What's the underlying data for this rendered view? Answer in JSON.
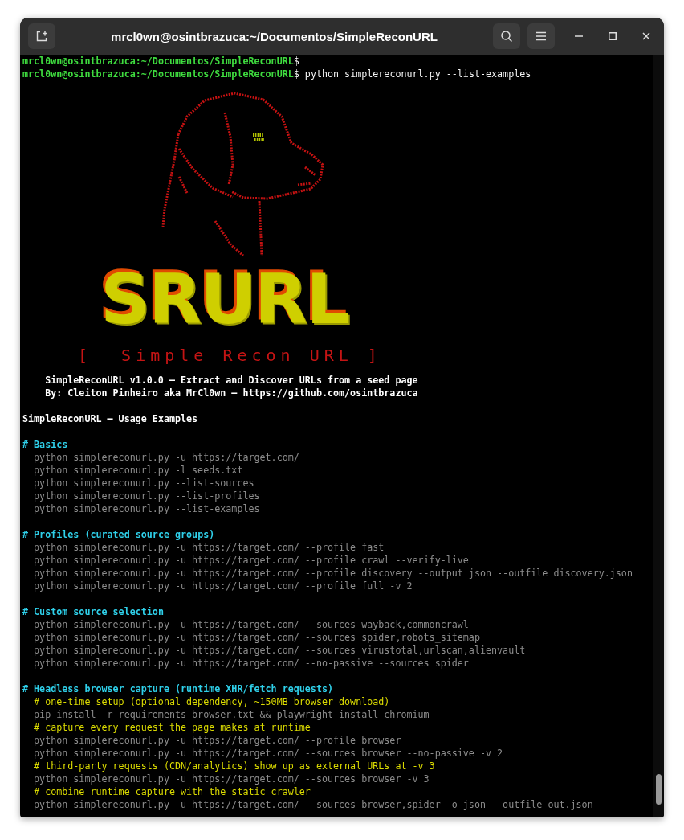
{
  "window": {
    "title": "mrcl0wn@osintbrazuca:~/Documentos/SimpleReconURL"
  },
  "terminal": {
    "prompts": [
      {
        "prompt": "mrcl0wn@osintbrazuca:~/Documentos/SimpleReconURL",
        "symbol": "$"
      },
      {
        "prompt": "mrcl0wn@osintbrazuca:~/Documentos/SimpleReconURL",
        "symbol": "$",
        "command": "python simplereconurl.py --list-examples"
      }
    ],
    "art": {
      "logo": "SRURL",
      "subtitle": "[  Simple Recon URL ]"
    },
    "banner": [
      "SimpleReconURL v1.0.0 – Extract and Discover URLs from a seed page",
      "By: Cleiton Pinheiro aka MrCl0wn – https://github.com/osintbrazuca"
    ],
    "title": "SimpleReconURL — Usage Examples",
    "sections": [
      {
        "heading": "# Basics",
        "lines": [
          {
            "kind": "command",
            "text": "python simplereconurl.py -u https://target.com/"
          },
          {
            "kind": "command",
            "text": "python simplereconurl.py -l seeds.txt"
          },
          {
            "kind": "command",
            "text": "python simplereconurl.py --list-sources"
          },
          {
            "kind": "command",
            "text": "python simplereconurl.py --list-profiles"
          },
          {
            "kind": "command",
            "text": "python simplereconurl.py --list-examples"
          }
        ]
      },
      {
        "heading": "# Profiles (curated source groups)",
        "lines": [
          {
            "kind": "command",
            "text": "python simplereconurl.py -u https://target.com/ --profile fast"
          },
          {
            "kind": "command",
            "text": "python simplereconurl.py -u https://target.com/ --profile crawl --verify-live"
          },
          {
            "kind": "command",
            "text": "python simplereconurl.py -u https://target.com/ --profile discovery --output json --outfile discovery.json"
          },
          {
            "kind": "command",
            "text": "python simplereconurl.py -u https://target.com/ --profile full -v 2"
          }
        ]
      },
      {
        "heading": "# Custom source selection",
        "lines": [
          {
            "kind": "command",
            "text": "python simplereconurl.py -u https://target.com/ --sources wayback,commoncrawl"
          },
          {
            "kind": "command",
            "text": "python simplereconurl.py -u https://target.com/ --sources spider,robots_sitemap"
          },
          {
            "kind": "command",
            "text": "python simplereconurl.py -u https://target.com/ --sources virustotal,urlscan,alienvault"
          },
          {
            "kind": "command",
            "text": "python simplereconurl.py -u https://target.com/ --no-passive --sources spider"
          }
        ]
      },
      {
        "heading": "# Headless browser capture (runtime XHR/fetch requests)",
        "lines": [
          {
            "kind": "comment",
            "text": "# one-time setup (optional dependency, ~150MB browser download)"
          },
          {
            "kind": "command",
            "text": "pip install -r requirements-browser.txt && playwright install chromium"
          },
          {
            "kind": "comment",
            "text": "# capture every request the page makes at runtime"
          },
          {
            "kind": "command",
            "text": "python simplereconurl.py -u https://target.com/ --profile browser"
          },
          {
            "kind": "command",
            "text": "python simplereconurl.py -u https://target.com/ --sources browser --no-passive -v 2"
          },
          {
            "kind": "comment",
            "text": "# third-party requests (CDN/analytics) show up as external URLs at -v 3"
          },
          {
            "kind": "command",
            "text": "python simplereconurl.py -u https://target.com/ --sources browser -v 3"
          },
          {
            "kind": "comment",
            "text": "# combine runtime capture with the static crawler"
          },
          {
            "kind": "command",
            "text": "python simplereconurl.py -u https://target.com/ --sources browser,spider -o json --outfile out.json"
          }
        ]
      }
    ]
  }
}
